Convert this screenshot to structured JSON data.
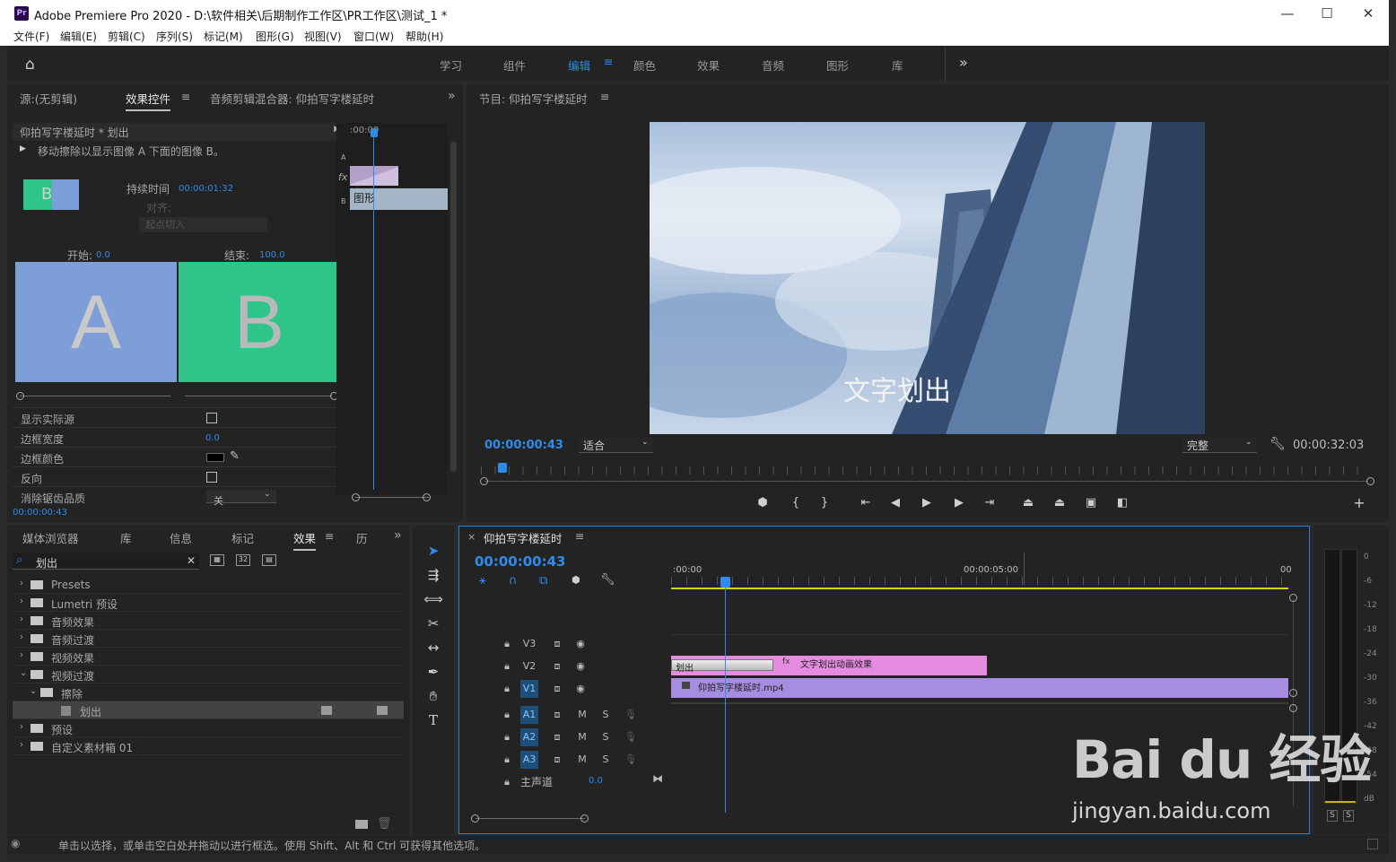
{
  "window": {
    "app_title": "Adobe Premiere Pro 2020 - D:\\软件相关\\后期制作工作区\\PR工作区\\测试_1 *",
    "logo": "Pr",
    "min": "—",
    "max": "☐",
    "close": "✕"
  },
  "menu": [
    "文件(F)",
    "编辑(E)",
    "剪辑(C)",
    "序列(S)",
    "标记(M)",
    "图形(G)",
    "视图(V)",
    "窗口(W)",
    "帮助(H)"
  ],
  "workspaces": [
    "学习",
    "组件",
    "编辑",
    "颜色",
    "效果",
    "音频",
    "图形",
    "库"
  ],
  "workspace_active": "编辑",
  "source_panel": {
    "tabs": [
      "源:(无剪辑)",
      "效果控件",
      "音频剪辑混合器: 仰拍写字楼延时"
    ],
    "active": "效果控件",
    "clip_header": "仰拍写字楼延时 * 划出",
    "description": "移动擦除以显示图像 A 下面的图像 B。",
    "duration_label": "持续时间",
    "duration_value": "00:00:01:32",
    "align_label": "对齐:",
    "align_value": "起点切入",
    "start_label": "开始:",
    "start_value": "0.0",
    "end_label": "结束:",
    "end_value": "100.0",
    "A": "A",
    "B": "B",
    "props": [
      {
        "label": "显示实际源"
      },
      {
        "label": "边框宽度",
        "value": "0.0"
      },
      {
        "label": "边框颜色"
      },
      {
        "label": "反向"
      },
      {
        "label": "消除锯齿品质",
        "value": "关"
      }
    ],
    "timecode": "00:00:00:43",
    "mini_tc": ":00:00",
    "mini_clip": "图形",
    "mini_A": "A",
    "mini_B": "B",
    "mini_fx": "fx"
  },
  "program": {
    "title": "节目: 仰拍写字楼延时",
    "overlay_text": "文字划出",
    "timecode": "00:00:00:43",
    "fit": "适合",
    "quality": "完整",
    "duration": "00:00:32:03"
  },
  "effects_panel": {
    "tabs": [
      "媒体浏览器",
      "库",
      "信息",
      "标记",
      "效果",
      "历"
    ],
    "active": "效果",
    "search": "划出",
    "items": [
      {
        "label": "Presets",
        "indent": 0
      },
      {
        "label": "Lumetri 预设",
        "indent": 0
      },
      {
        "label": "音频效果",
        "indent": 0
      },
      {
        "label": "音频过渡",
        "indent": 0
      },
      {
        "label": "视频效果",
        "indent": 0
      },
      {
        "label": "视频过渡",
        "indent": 0,
        "open": true
      },
      {
        "label": "擦除",
        "indent": 1,
        "open": true
      },
      {
        "label": "划出",
        "indent": 2,
        "selected": true
      },
      {
        "label": "预设",
        "indent": 0
      },
      {
        "label": "自定义素材箱 01",
        "indent": 0
      }
    ]
  },
  "timeline": {
    "title": "仰拍写字楼延时",
    "timecode": "00:00:00:43",
    "ruler": [
      ":00:00",
      "00:00:05:00",
      "00"
    ],
    "tracks_v": [
      "V3",
      "V2",
      "V1"
    ],
    "tracks_a": [
      "A1",
      "A2",
      "A3"
    ],
    "master": "主声道",
    "master_val": "0.0",
    "clip_v2_trans": "划出",
    "clip_v2": "文字划出动画效果",
    "clip_v1": "仰拍写字楼延时.mp4",
    "m": "M",
    "s": "S"
  },
  "meter": {
    "ticks": [
      "0",
      "-6",
      "-12",
      "-18",
      "-24",
      "-30",
      "-36",
      "-42",
      "-48",
      "-54",
      "dB"
    ],
    "solo": [
      "S",
      "S"
    ]
  },
  "status": "单击以选择，或单击空白处并拖动以进行框选。使用 Shift、Alt 和 Ctrl 可获得其他选项。",
  "watermark": {
    "brand": "Bai du 经验",
    "url": "jingyan.baidu.com"
  }
}
